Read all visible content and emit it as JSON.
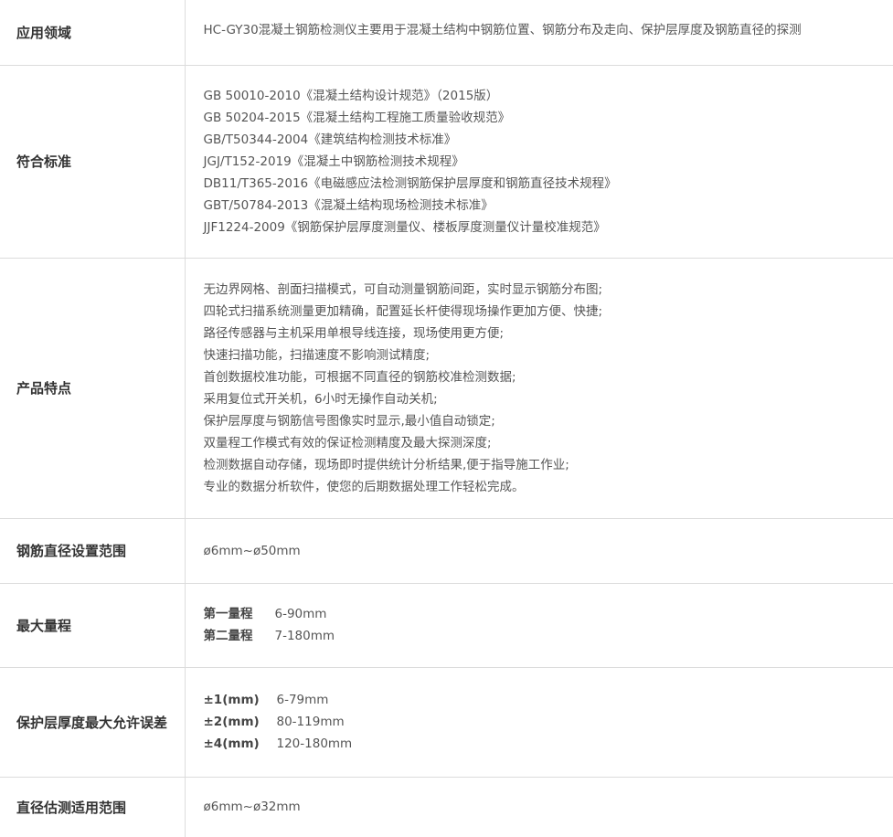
{
  "rows": [
    {
      "label": "应用领域",
      "lines": [
        "HC-GY30混凝土钢筋检测仪主要用于混凝土结构中钢筋位置、钢筋分布及走向、保护层厚度及钢筋直径的探测"
      ]
    },
    {
      "label": "符合标准",
      "lines": [
        "GB 50010-2010《混凝土结构设计规范》（2015版）",
        "GB 50204-2015《混凝土结构工程施工质量验收规范》",
        "GB/T50344-2004《建筑结构检测技术标准》",
        "JGJ/T152-2019《混凝土中钢筋检测技术规程》",
        "DB11/T365-2016《电磁感应法检测钢筋保护层厚度和钢筋直径技术规程》",
        "GBT/50784-2013《混凝土结构现场检测技术标准》",
        "JJF1224-2009《钢筋保护层厚度测量仪、楼板厚度测量仪计量校准规范》"
      ]
    },
    {
      "label": "产品特点",
      "lines": [
        "无边界网格、剖面扫描模式，可自动测量钢筋间距，实时显示钢筋分布图;",
        "四轮式扫描系统测量更加精确，配置延长杆使得现场操作更加方便、快捷;",
        "路径传感器与主机采用单根导线连接，现场使用更方便;",
        "快速扫描功能，扫描速度不影响测试精度;",
        "首创数据校准功能，可根据不同直径的钢筋校准检测数据;",
        "采用复位式开关机，6小时无操作自动关机;",
        "保护层厚度与钢筋信号图像实时显示,最小值自动锁定;",
        "双量程工作模式有效的保证检测精度及最大探测深度;",
        "检测数据自动存储，现场即时提供统计分析结果,便于指导施工作业;",
        "专业的数据分析软件，使您的后期数据处理工作轻松完成。"
      ]
    },
    {
      "label": "钢筋直径设置范围",
      "lines": [
        "ø6mm~ø50mm"
      ]
    },
    {
      "label": "最大量程",
      "pairs": [
        {
          "key": "第一量程",
          "value": "6-90mm"
        },
        {
          "key": "第二量程",
          "value": "7-180mm"
        }
      ]
    },
    {
      "label": "保护层厚度最大允许误差",
      "pairs": [
        {
          "key": "±1(mm)",
          "value": "6-79mm"
        },
        {
          "key": "±2(mm)",
          "value": "80-119mm"
        },
        {
          "key": "±4(mm)",
          "value": "120-180mm"
        }
      ]
    },
    {
      "label": "直径估测适用范围",
      "lines": [
        "ø6mm~ø32mm"
      ]
    }
  ]
}
